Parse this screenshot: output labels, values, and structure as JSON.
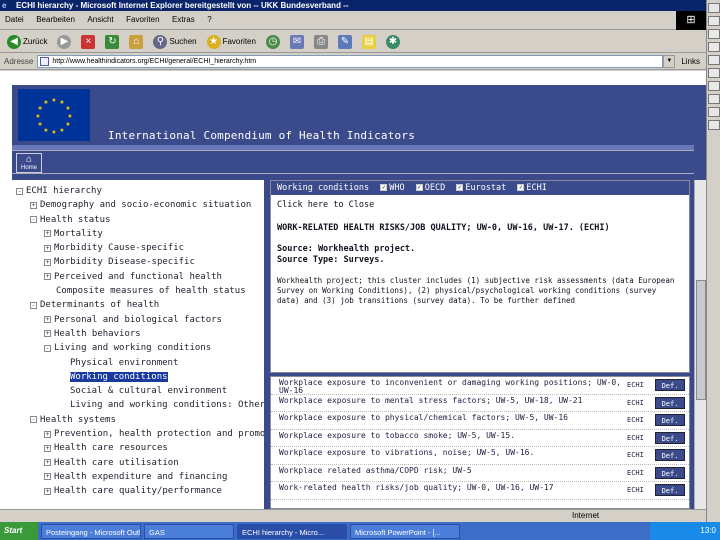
{
  "window": {
    "title": "ECHI hierarchy - Microsoft Internet Explorer bereitgestellt von -- UKK Bundesverband --"
  },
  "menu": [
    "Datei",
    "Bearbeiten",
    "Ansicht",
    "Favoriten",
    "Extras",
    "?"
  ],
  "toolbar": {
    "back_label": "Zurück",
    "search_label": "Suchen",
    "favorites_label": "Favoriten"
  },
  "address": {
    "label": "Adresse",
    "url": "http://www.healthindicators.org/ECHI/general/ECHI_hierarchy.htm",
    "links_label": "Links"
  },
  "site": {
    "title": "International Compendium of Health Indicators",
    "home_label": "Home"
  },
  "tree": [
    {
      "label": "ECHI hierarchy",
      "indent": 0,
      "box": "-"
    },
    {
      "label": "Demography and socio-economic situation",
      "indent": 1,
      "box": "+"
    },
    {
      "label": "Health status",
      "indent": 1,
      "box": "-"
    },
    {
      "label": "Mortality",
      "indent": 2,
      "box": "+"
    },
    {
      "label": "Morbidity Cause-specific",
      "indent": 2,
      "box": "+"
    },
    {
      "label": "Morbidity Disease-specific",
      "indent": 2,
      "box": "+"
    },
    {
      "label": "Perceived and functional health",
      "indent": 2,
      "box": "+"
    },
    {
      "label": "Composite measures of health status",
      "indent": 2,
      "box": ""
    },
    {
      "label": "Determinants of health",
      "indent": 1,
      "box": "-"
    },
    {
      "label": "Personal and biological factors",
      "indent": 2,
      "box": "+"
    },
    {
      "label": "Health behaviors",
      "indent": 2,
      "box": "+"
    },
    {
      "label": "Living and working conditions",
      "indent": 2,
      "box": "-"
    },
    {
      "label": "Physical environment",
      "indent": 3,
      "box": ""
    },
    {
      "label": "Working conditions",
      "indent": 3,
      "box": "",
      "selected": true
    },
    {
      "label": "Social & cultural environment",
      "indent": 3,
      "box": ""
    },
    {
      "label": "Living and working conditions: Other",
      "indent": 3,
      "box": ""
    },
    {
      "label": "Health systems",
      "indent": 1,
      "box": "-"
    },
    {
      "label": "Prevention, health protection and promotion",
      "indent": 2,
      "box": "+"
    },
    {
      "label": "Health care resources",
      "indent": 2,
      "box": "+"
    },
    {
      "label": "Health care utilisation",
      "indent": 2,
      "box": "+"
    },
    {
      "label": "Health expenditure and financing",
      "indent": 2,
      "box": "+"
    },
    {
      "label": "Health care quality/performance",
      "indent": 2,
      "box": "+"
    }
  ],
  "detail": {
    "header_title": "Working conditions",
    "filters": [
      "WHO",
      "OECD",
      "Eurostat",
      "ECHI"
    ],
    "close_link": "Click here to Close",
    "heading": "WORK-RELATED HEALTH RISKS/JOB QUALITY; UW-0, UW-16, UW-17. (ECHI)",
    "source": "Source: Workhealth project.",
    "source_type": "Source Type: Surveys.",
    "description": "Workhealth project; this cluster includes (1) subjective risk assessments (data European Survey on Working Conditions), (2) physical/psychological working conditions (survey data) and (3) job transitions (survey data). To be further defined"
  },
  "indicators": [
    {
      "text": "Workplace exposure to inconvenient or damaging working positions; UW-0, UW-16",
      "source": "ECHI",
      "def": "Def."
    },
    {
      "text": "Workplace exposure to mental stress factors; UW-5, UW-18, UW-21",
      "source": "ECHI",
      "def": "Def."
    },
    {
      "text": "Workplace exposure to physical/chemical factors; UW-5, UW-16",
      "source": "ECHI",
      "def": "Def."
    },
    {
      "text": "Workplace exposure to tobacco smoke; UW-5, UW-15.",
      "source": "ECHI",
      "def": "Def."
    },
    {
      "text": "Workplace exposure to vibrations, noise; UW-5, UW-16.",
      "source": "ECHI",
      "def": "Def."
    },
    {
      "text": "Workplace related asthma/COPD risk; UW-5",
      "source": "ECHI",
      "def": "Def."
    },
    {
      "text": "Work-related health risks/job quality; UW-0, UW-16, UW-17",
      "source": "ECHI",
      "def": "Def."
    }
  ],
  "status": {
    "zone": "Internet"
  },
  "taskbar": {
    "start": "Start",
    "tasks": [
      "Posteingang - Microsoft Outlook",
      "GAS",
      "ECHI hierarchy - Micro...",
      "Microsoft PowerPoint - [..."
    ],
    "clock": "13:0"
  }
}
